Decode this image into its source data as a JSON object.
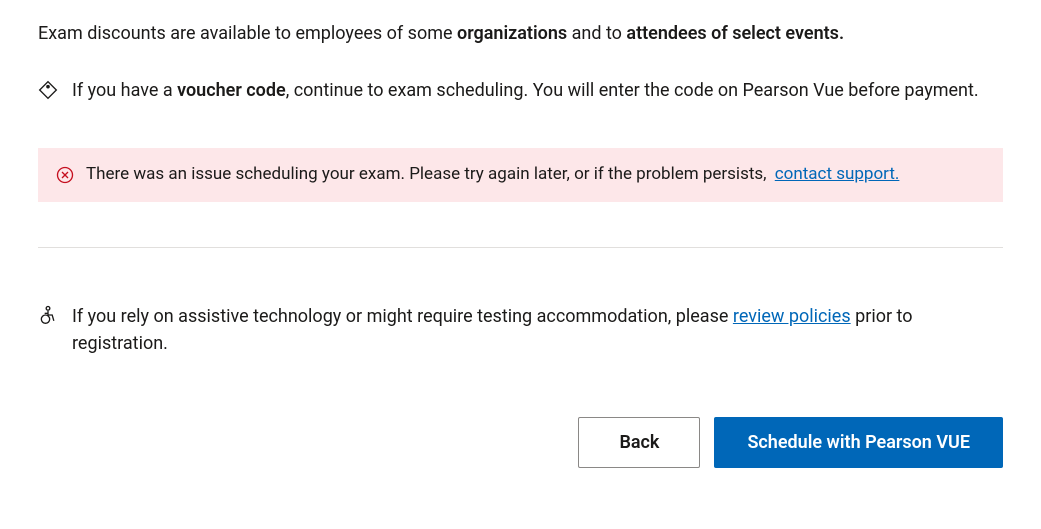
{
  "intro": {
    "prefix": "Exam discounts are available to employees of some ",
    "bold1": "organizations",
    "mid": " and to ",
    "bold2": "attendees of select events."
  },
  "voucher": {
    "prefix": "If you have a ",
    "bold": "voucher code",
    "suffix": ", continue to exam scheduling. You will enter the code on Pearson Vue before payment."
  },
  "error": {
    "message": "There was an issue scheduling your exam. Please try again later, or if the problem persists, ",
    "link_label": "contact support."
  },
  "accessibility": {
    "prefix": "If you rely on assistive technology or might require testing accommodation, please ",
    "link_label": "review policies",
    "suffix": " prior to registration."
  },
  "buttons": {
    "back": "Back",
    "schedule": "Schedule with Pearson VUE"
  }
}
